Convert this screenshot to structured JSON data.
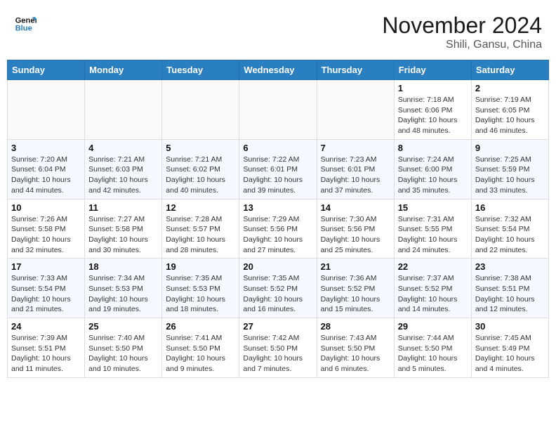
{
  "header": {
    "logo_line1": "General",
    "logo_line2": "Blue",
    "month": "November 2024",
    "location": "Shili, Gansu, China"
  },
  "weekdays": [
    "Sunday",
    "Monday",
    "Tuesday",
    "Wednesday",
    "Thursday",
    "Friday",
    "Saturday"
  ],
  "weeks": [
    [
      {
        "day": "",
        "info": ""
      },
      {
        "day": "",
        "info": ""
      },
      {
        "day": "",
        "info": ""
      },
      {
        "day": "",
        "info": ""
      },
      {
        "day": "",
        "info": ""
      },
      {
        "day": "1",
        "info": "Sunrise: 7:18 AM\nSunset: 6:06 PM\nDaylight: 10 hours\nand 48 minutes."
      },
      {
        "day": "2",
        "info": "Sunrise: 7:19 AM\nSunset: 6:05 PM\nDaylight: 10 hours\nand 46 minutes."
      }
    ],
    [
      {
        "day": "3",
        "info": "Sunrise: 7:20 AM\nSunset: 6:04 PM\nDaylight: 10 hours\nand 44 minutes."
      },
      {
        "day": "4",
        "info": "Sunrise: 7:21 AM\nSunset: 6:03 PM\nDaylight: 10 hours\nand 42 minutes."
      },
      {
        "day": "5",
        "info": "Sunrise: 7:21 AM\nSunset: 6:02 PM\nDaylight: 10 hours\nand 40 minutes."
      },
      {
        "day": "6",
        "info": "Sunrise: 7:22 AM\nSunset: 6:01 PM\nDaylight: 10 hours\nand 39 minutes."
      },
      {
        "day": "7",
        "info": "Sunrise: 7:23 AM\nSunset: 6:01 PM\nDaylight: 10 hours\nand 37 minutes."
      },
      {
        "day": "8",
        "info": "Sunrise: 7:24 AM\nSunset: 6:00 PM\nDaylight: 10 hours\nand 35 minutes."
      },
      {
        "day": "9",
        "info": "Sunrise: 7:25 AM\nSunset: 5:59 PM\nDaylight: 10 hours\nand 33 minutes."
      }
    ],
    [
      {
        "day": "10",
        "info": "Sunrise: 7:26 AM\nSunset: 5:58 PM\nDaylight: 10 hours\nand 32 minutes."
      },
      {
        "day": "11",
        "info": "Sunrise: 7:27 AM\nSunset: 5:58 PM\nDaylight: 10 hours\nand 30 minutes."
      },
      {
        "day": "12",
        "info": "Sunrise: 7:28 AM\nSunset: 5:57 PM\nDaylight: 10 hours\nand 28 minutes."
      },
      {
        "day": "13",
        "info": "Sunrise: 7:29 AM\nSunset: 5:56 PM\nDaylight: 10 hours\nand 27 minutes."
      },
      {
        "day": "14",
        "info": "Sunrise: 7:30 AM\nSunset: 5:56 PM\nDaylight: 10 hours\nand 25 minutes."
      },
      {
        "day": "15",
        "info": "Sunrise: 7:31 AM\nSunset: 5:55 PM\nDaylight: 10 hours\nand 24 minutes."
      },
      {
        "day": "16",
        "info": "Sunrise: 7:32 AM\nSunset: 5:54 PM\nDaylight: 10 hours\nand 22 minutes."
      }
    ],
    [
      {
        "day": "17",
        "info": "Sunrise: 7:33 AM\nSunset: 5:54 PM\nDaylight: 10 hours\nand 21 minutes."
      },
      {
        "day": "18",
        "info": "Sunrise: 7:34 AM\nSunset: 5:53 PM\nDaylight: 10 hours\nand 19 minutes."
      },
      {
        "day": "19",
        "info": "Sunrise: 7:35 AM\nSunset: 5:53 PM\nDaylight: 10 hours\nand 18 minutes."
      },
      {
        "day": "20",
        "info": "Sunrise: 7:35 AM\nSunset: 5:52 PM\nDaylight: 10 hours\nand 16 minutes."
      },
      {
        "day": "21",
        "info": "Sunrise: 7:36 AM\nSunset: 5:52 PM\nDaylight: 10 hours\nand 15 minutes."
      },
      {
        "day": "22",
        "info": "Sunrise: 7:37 AM\nSunset: 5:52 PM\nDaylight: 10 hours\nand 14 minutes."
      },
      {
        "day": "23",
        "info": "Sunrise: 7:38 AM\nSunset: 5:51 PM\nDaylight: 10 hours\nand 12 minutes."
      }
    ],
    [
      {
        "day": "24",
        "info": "Sunrise: 7:39 AM\nSunset: 5:51 PM\nDaylight: 10 hours\nand 11 minutes."
      },
      {
        "day": "25",
        "info": "Sunrise: 7:40 AM\nSunset: 5:50 PM\nDaylight: 10 hours\nand 10 minutes."
      },
      {
        "day": "26",
        "info": "Sunrise: 7:41 AM\nSunset: 5:50 PM\nDaylight: 10 hours\nand 9 minutes."
      },
      {
        "day": "27",
        "info": "Sunrise: 7:42 AM\nSunset: 5:50 PM\nDaylight: 10 hours\nand 7 minutes."
      },
      {
        "day": "28",
        "info": "Sunrise: 7:43 AM\nSunset: 5:50 PM\nDaylight: 10 hours\nand 6 minutes."
      },
      {
        "day": "29",
        "info": "Sunrise: 7:44 AM\nSunset: 5:50 PM\nDaylight: 10 hours\nand 5 minutes."
      },
      {
        "day": "30",
        "info": "Sunrise: 7:45 AM\nSunset: 5:49 PM\nDaylight: 10 hours\nand 4 minutes."
      }
    ]
  ]
}
